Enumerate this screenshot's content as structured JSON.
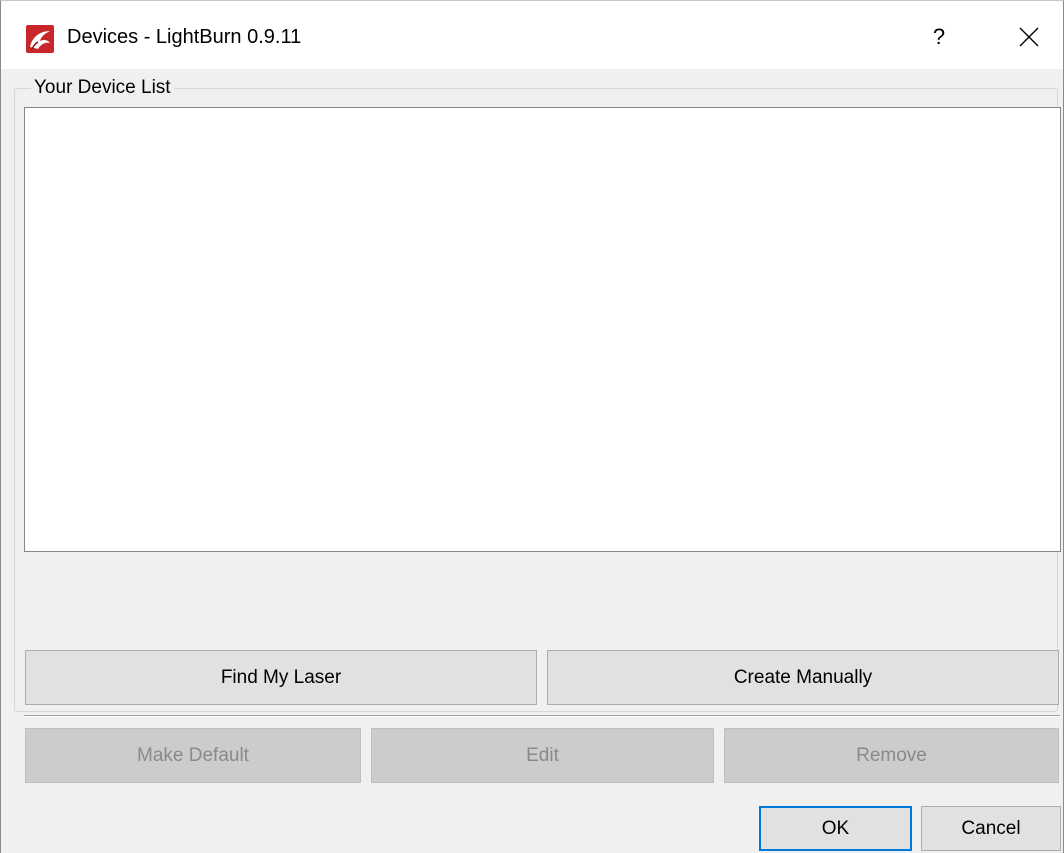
{
  "window": {
    "title": "Devices - LightBurn 0.9.11",
    "help_label": "?",
    "close_icon": "close-icon",
    "app_icon": "lightburn-logo-icon",
    "accent_color": "#0078d7"
  },
  "device_group": {
    "label": "Your Device List",
    "devices": []
  },
  "actions": {
    "find_label": "Find My Laser",
    "create_label": "Create Manually"
  },
  "device_actions": {
    "make_default_label": "Make Default",
    "edit_label": "Edit",
    "remove_label": "Remove"
  },
  "dialog_buttons": {
    "ok_label": "OK",
    "cancel_label": "Cancel"
  }
}
